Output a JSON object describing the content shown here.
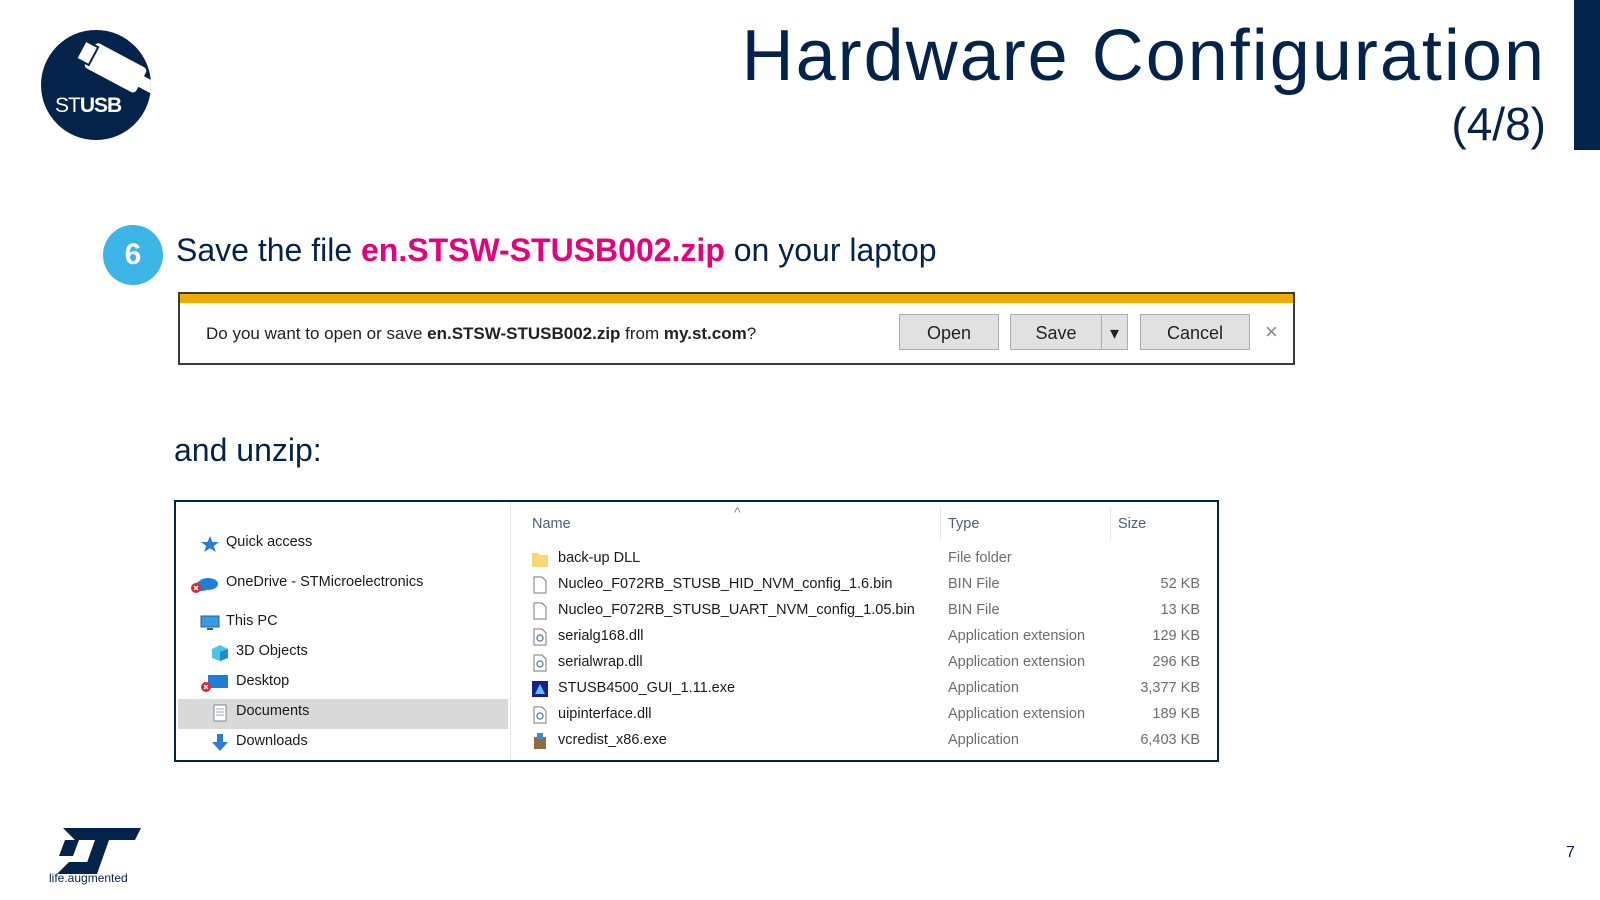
{
  "brand": {
    "logo_text_light": "ST",
    "logo_text_bold": "USB",
    "st_tagline": "life.augmented",
    "navy": "#03234b",
    "cyan": "#3cb4e6",
    "magenta": "#e6007e",
    "amber": "#f0ab00"
  },
  "header": {
    "title": "Hardware Configuration",
    "subtitle": "(4/8)"
  },
  "step": {
    "number": "6",
    "prefix": "Save the file ",
    "filename": "en.STSW-STUSB002.zip",
    "suffix": " on your laptop"
  },
  "download_bar": {
    "msg_prefix": "Do you want to open or save ",
    "file": "en.STSW-STUSB002.zip",
    "msg_mid": " from ",
    "site": "my.st.com",
    "msg_end": "?",
    "open_label": "Open",
    "save_label": "Save",
    "dropdown_icon": "▾",
    "cancel_label": "Cancel",
    "close_icon": "×"
  },
  "unzip_text": "and unzip:",
  "explorer": {
    "nav": [
      {
        "label": "Quick access",
        "icon": "star-icon"
      },
      {
        "label": "OneDrive - STMicroelectronics",
        "icon": "cloud-icon"
      },
      {
        "label": "This PC",
        "icon": "computer-icon"
      },
      {
        "label": "3D Objects",
        "icon": "cube-icon"
      },
      {
        "label": "Desktop",
        "icon": "desktop-icon"
      },
      {
        "label": "Documents",
        "icon": "document-icon",
        "selected": true
      },
      {
        "label": "Downloads",
        "icon": "download-arrow-icon"
      }
    ],
    "columns": {
      "name": "Name",
      "type": "Type",
      "size": "Size"
    },
    "files": [
      {
        "name": "back-up DLL",
        "type": "File folder",
        "size": "",
        "icon": "folder-icon"
      },
      {
        "name": "Nucleo_F072RB_STUSB_HID_NVM_config_1.6.bin",
        "type": "BIN File",
        "size": "52 KB",
        "icon": "file-icon"
      },
      {
        "name": "Nucleo_F072RB_STUSB_UART_NVM_config_1.05.bin",
        "type": "BIN File",
        "size": "13 KB",
        "icon": "file-icon"
      },
      {
        "name": "serialg168.dll",
        "type": "Application extension",
        "size": "129 KB",
        "icon": "dll-icon"
      },
      {
        "name": "serialwrap.dll",
        "type": "Application extension",
        "size": "296 KB",
        "icon": "dll-icon"
      },
      {
        "name": "STUSB4500_GUI_1.11.exe",
        "type": "Application",
        "size": "3,377 KB",
        "icon": "app-icon"
      },
      {
        "name": "uipinterface.dll",
        "type": "Application extension",
        "size": "189 KB",
        "icon": "dll-icon"
      },
      {
        "name": "vcredist_x86.exe",
        "type": "Application",
        "size": "6,403 KB",
        "icon": "installer-icon"
      }
    ]
  },
  "page_number": "7"
}
